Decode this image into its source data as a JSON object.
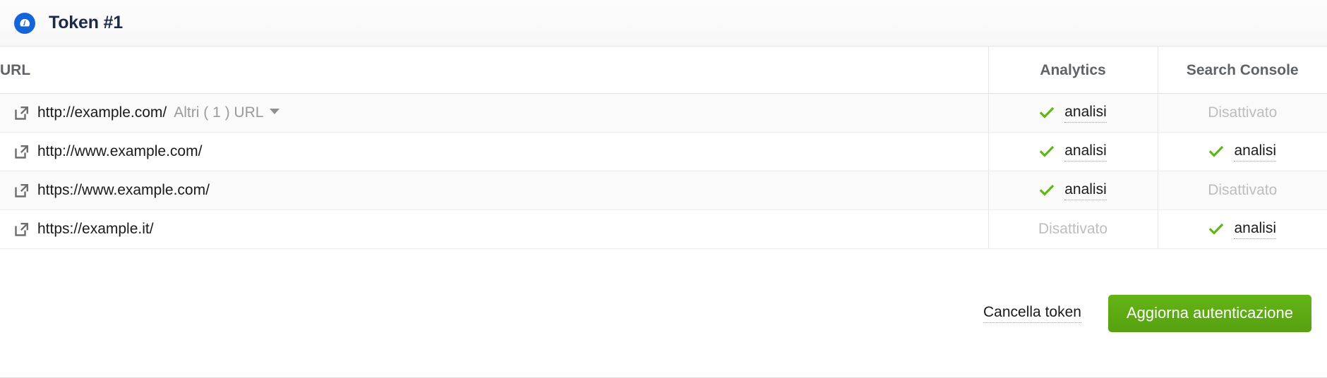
{
  "header": {
    "icon": "gauge-icon",
    "title": "Token #1",
    "icon_color": "#1565d8"
  },
  "table": {
    "columns": [
      {
        "key": "url",
        "label": "URL",
        "align": "left"
      },
      {
        "key": "analytics",
        "label": "Analytics",
        "align": "center"
      },
      {
        "key": "search_console",
        "label": "Search Console",
        "align": "center"
      }
    ],
    "rows": [
      {
        "url": "http://example.com/",
        "more_label": "Altri ( 1 ) URL",
        "has_more": true,
        "analytics": {
          "state": "on",
          "label": "analisi"
        },
        "search_console": {
          "state": "off",
          "label": "Disattivato"
        }
      },
      {
        "url": "http://www.example.com/",
        "more_label": "",
        "has_more": false,
        "analytics": {
          "state": "on",
          "label": "analisi"
        },
        "search_console": {
          "state": "on",
          "label": "analisi"
        }
      },
      {
        "url": "https://www.example.com/",
        "more_label": "",
        "has_more": false,
        "analytics": {
          "state": "on",
          "label": "analisi"
        },
        "search_console": {
          "state": "off",
          "label": "Disattivato"
        }
      },
      {
        "url": "https://example.it/",
        "more_label": "",
        "has_more": false,
        "analytics": {
          "state": "off",
          "label": "Disattivato"
        },
        "search_console": {
          "state": "on",
          "label": "analisi"
        }
      }
    ]
  },
  "footer": {
    "delete_label": "Cancella token",
    "update_label": "Aggiorna autenticazione",
    "update_color": "#5aa814"
  },
  "colors": {
    "check_green": "#62b516",
    "disabled_grey": "#bdbdbd",
    "link_icon_grey": "#6e6e6e",
    "title_navy": "#1b2a4a"
  }
}
